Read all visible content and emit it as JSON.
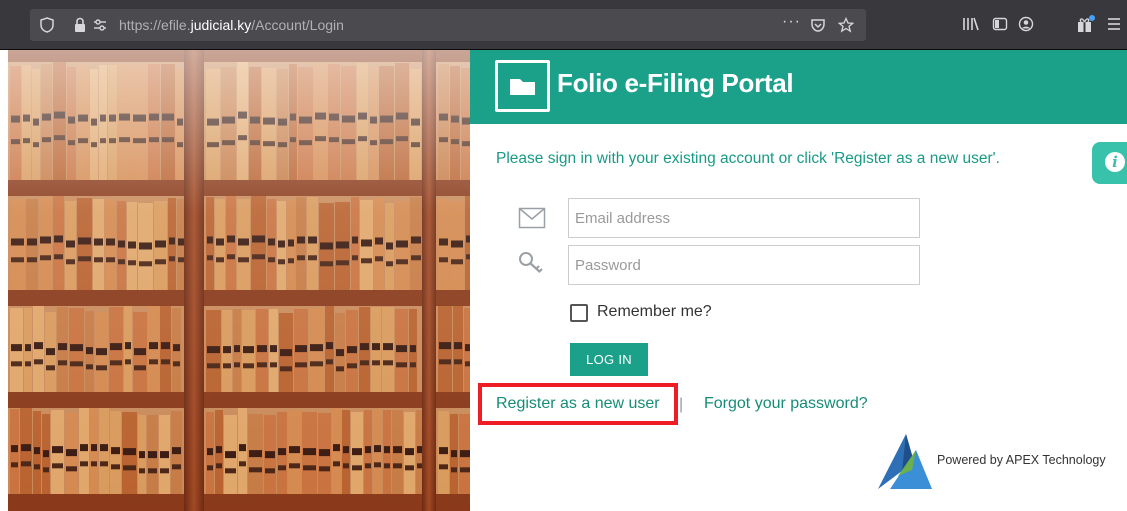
{
  "browser": {
    "url_prefix": "https://efile.",
    "url_host": "judicial.ky",
    "url_path": "/Account/Login",
    "shield_icon": "shield-icon",
    "lock_icon": "lock-icon",
    "page_actions": "···"
  },
  "header": {
    "title": "Folio e-Filing Portal",
    "color": "#1ba18a"
  },
  "login": {
    "intro": "Please sign in with your existing account or click 'Register as a new user'.",
    "email_placeholder": "Email address",
    "password_placeholder": "Password",
    "remember_label": "Remember me?",
    "login_label": "LOG IN"
  },
  "links": {
    "register": "Register as a new user",
    "separator": "|",
    "forgot": "Forgot your password?"
  },
  "footer": {
    "powered_by": "Powered by APEX Technology"
  },
  "colors": {
    "accent": "#1ba18a",
    "highlight": "#ee1c25",
    "info_tab": "#38c2ab"
  }
}
